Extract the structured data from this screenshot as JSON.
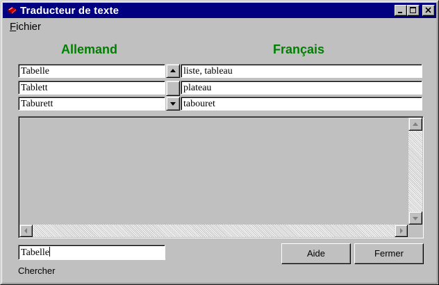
{
  "window": {
    "title": "Traducteur de texte"
  },
  "menu": {
    "file_prefix": "F",
    "file_rest": "ichier"
  },
  "headers": {
    "source_language": "Allemand",
    "target_language": "Français"
  },
  "rows": [
    {
      "source": "Tabelle",
      "target": "liste, tableau"
    },
    {
      "source": "Tablett",
      "target": "plateau"
    },
    {
      "source": "Taburett",
      "target": "tabouret"
    }
  ],
  "search": {
    "value": "Tabelle",
    "label": "Chercher"
  },
  "buttons": {
    "help": "Aide",
    "close": "Fermer"
  },
  "icons": {
    "app": "red-book-icon",
    "minimize": "minimize-icon",
    "maximize": "maximize-icon",
    "close": "close-icon",
    "scroll_up": "arrow-up-icon",
    "scroll_down": "arrow-down-icon",
    "scroll_left": "arrow-left-icon",
    "scroll_right": "arrow-right-icon"
  },
  "colors": {
    "title_bar": "#000080",
    "header_text": "#008000",
    "face": "#c0c0c0"
  }
}
